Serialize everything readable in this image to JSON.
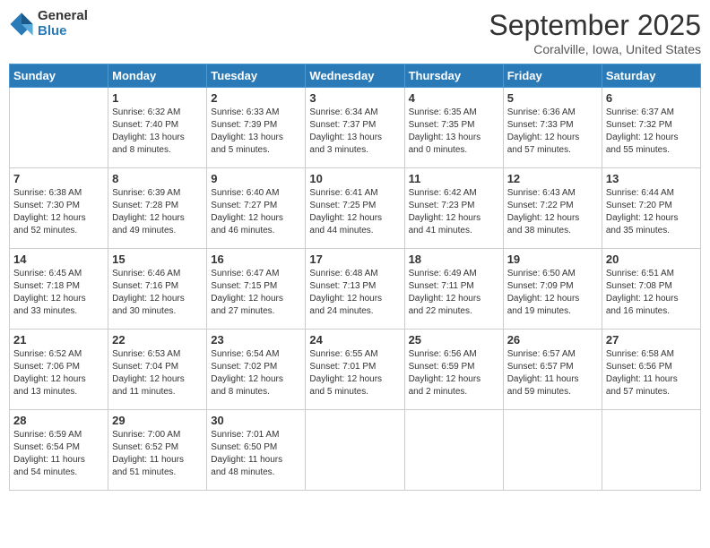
{
  "header": {
    "logo_general": "General",
    "logo_blue": "Blue",
    "month_title": "September 2025",
    "location": "Coralville, Iowa, United States"
  },
  "weekdays": [
    "Sunday",
    "Monday",
    "Tuesday",
    "Wednesday",
    "Thursday",
    "Friday",
    "Saturday"
  ],
  "weeks": [
    [
      {
        "day": "",
        "info": ""
      },
      {
        "day": "1",
        "info": "Sunrise: 6:32 AM\nSunset: 7:40 PM\nDaylight: 13 hours\nand 8 minutes."
      },
      {
        "day": "2",
        "info": "Sunrise: 6:33 AM\nSunset: 7:39 PM\nDaylight: 13 hours\nand 5 minutes."
      },
      {
        "day": "3",
        "info": "Sunrise: 6:34 AM\nSunset: 7:37 PM\nDaylight: 13 hours\nand 3 minutes."
      },
      {
        "day": "4",
        "info": "Sunrise: 6:35 AM\nSunset: 7:35 PM\nDaylight: 13 hours\nand 0 minutes."
      },
      {
        "day": "5",
        "info": "Sunrise: 6:36 AM\nSunset: 7:33 PM\nDaylight: 12 hours\nand 57 minutes."
      },
      {
        "day": "6",
        "info": "Sunrise: 6:37 AM\nSunset: 7:32 PM\nDaylight: 12 hours\nand 55 minutes."
      }
    ],
    [
      {
        "day": "7",
        "info": "Sunrise: 6:38 AM\nSunset: 7:30 PM\nDaylight: 12 hours\nand 52 minutes."
      },
      {
        "day": "8",
        "info": "Sunrise: 6:39 AM\nSunset: 7:28 PM\nDaylight: 12 hours\nand 49 minutes."
      },
      {
        "day": "9",
        "info": "Sunrise: 6:40 AM\nSunset: 7:27 PM\nDaylight: 12 hours\nand 46 minutes."
      },
      {
        "day": "10",
        "info": "Sunrise: 6:41 AM\nSunset: 7:25 PM\nDaylight: 12 hours\nand 44 minutes."
      },
      {
        "day": "11",
        "info": "Sunrise: 6:42 AM\nSunset: 7:23 PM\nDaylight: 12 hours\nand 41 minutes."
      },
      {
        "day": "12",
        "info": "Sunrise: 6:43 AM\nSunset: 7:22 PM\nDaylight: 12 hours\nand 38 minutes."
      },
      {
        "day": "13",
        "info": "Sunrise: 6:44 AM\nSunset: 7:20 PM\nDaylight: 12 hours\nand 35 minutes."
      }
    ],
    [
      {
        "day": "14",
        "info": "Sunrise: 6:45 AM\nSunset: 7:18 PM\nDaylight: 12 hours\nand 33 minutes."
      },
      {
        "day": "15",
        "info": "Sunrise: 6:46 AM\nSunset: 7:16 PM\nDaylight: 12 hours\nand 30 minutes."
      },
      {
        "day": "16",
        "info": "Sunrise: 6:47 AM\nSunset: 7:15 PM\nDaylight: 12 hours\nand 27 minutes."
      },
      {
        "day": "17",
        "info": "Sunrise: 6:48 AM\nSunset: 7:13 PM\nDaylight: 12 hours\nand 24 minutes."
      },
      {
        "day": "18",
        "info": "Sunrise: 6:49 AM\nSunset: 7:11 PM\nDaylight: 12 hours\nand 22 minutes."
      },
      {
        "day": "19",
        "info": "Sunrise: 6:50 AM\nSunset: 7:09 PM\nDaylight: 12 hours\nand 19 minutes."
      },
      {
        "day": "20",
        "info": "Sunrise: 6:51 AM\nSunset: 7:08 PM\nDaylight: 12 hours\nand 16 minutes."
      }
    ],
    [
      {
        "day": "21",
        "info": "Sunrise: 6:52 AM\nSunset: 7:06 PM\nDaylight: 12 hours\nand 13 minutes."
      },
      {
        "day": "22",
        "info": "Sunrise: 6:53 AM\nSunset: 7:04 PM\nDaylight: 12 hours\nand 11 minutes."
      },
      {
        "day": "23",
        "info": "Sunrise: 6:54 AM\nSunset: 7:02 PM\nDaylight: 12 hours\nand 8 minutes."
      },
      {
        "day": "24",
        "info": "Sunrise: 6:55 AM\nSunset: 7:01 PM\nDaylight: 12 hours\nand 5 minutes."
      },
      {
        "day": "25",
        "info": "Sunrise: 6:56 AM\nSunset: 6:59 PM\nDaylight: 12 hours\nand 2 minutes."
      },
      {
        "day": "26",
        "info": "Sunrise: 6:57 AM\nSunset: 6:57 PM\nDaylight: 11 hours\nand 59 minutes."
      },
      {
        "day": "27",
        "info": "Sunrise: 6:58 AM\nSunset: 6:56 PM\nDaylight: 11 hours\nand 57 minutes."
      }
    ],
    [
      {
        "day": "28",
        "info": "Sunrise: 6:59 AM\nSunset: 6:54 PM\nDaylight: 11 hours\nand 54 minutes."
      },
      {
        "day": "29",
        "info": "Sunrise: 7:00 AM\nSunset: 6:52 PM\nDaylight: 11 hours\nand 51 minutes."
      },
      {
        "day": "30",
        "info": "Sunrise: 7:01 AM\nSunset: 6:50 PM\nDaylight: 11 hours\nand 48 minutes."
      },
      {
        "day": "",
        "info": ""
      },
      {
        "day": "",
        "info": ""
      },
      {
        "day": "",
        "info": ""
      },
      {
        "day": "",
        "info": ""
      }
    ]
  ]
}
